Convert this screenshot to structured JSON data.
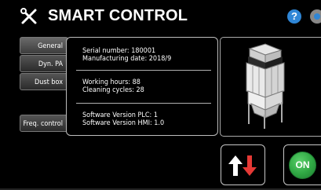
{
  "header": {
    "title": "SMART CONTROL",
    "help_symbol": "?",
    "icons": [
      "tools-icon",
      "help-icon",
      "settings-icon"
    ]
  },
  "tabs": [
    {
      "label": "General",
      "active": true
    },
    {
      "label": "Dyn. PA",
      "active": false
    },
    {
      "label": "Dust box",
      "active": false
    },
    {
      "label": "Freq. control",
      "active": false
    }
  ],
  "info": {
    "serial": "Serial number: 180001",
    "manufacturing": "Manufacturing date: 2018/9",
    "working_hours": "Working hours: 88",
    "cleaning_cycles": "Cleaning cycles: 28",
    "sw_plc": "Software Version PLC: 1",
    "sw_hmi": "Software Version HMI: 1.0"
  },
  "controls": {
    "reverse_icon": "up-down-arrows-icon",
    "on_label": "ON"
  },
  "colors": {
    "accent_red": "#e53935",
    "help_blue": "#2f86d6",
    "on_green": "#2fa743"
  }
}
